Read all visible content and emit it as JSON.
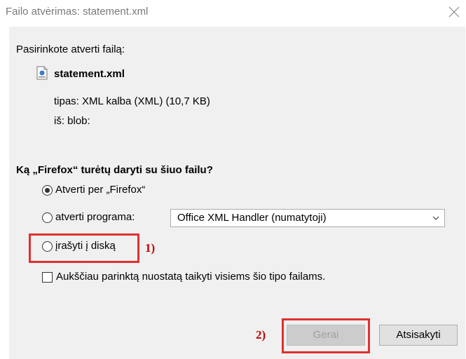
{
  "window": {
    "title": "Failo atvėrimas: statement.xml"
  },
  "intro": "Pasirinkote atverti failą:",
  "file": {
    "icon": "xml-file-icon",
    "name": "statement.xml",
    "type_line": "tipas: XML kalba (XML) (10,7 KB)",
    "from_line": "iš: blob:"
  },
  "question": "Ką „Firefox“ turėtų daryti su šiuo failu?",
  "options": {
    "open_firefox": {
      "label": "Atverti per „Firefox“",
      "checked": true
    },
    "open_program": {
      "label": "atverti programa:",
      "checked": false
    },
    "save_disk": {
      "label": "įrašyti į diską",
      "checked": false
    }
  },
  "program_select": {
    "value": "Office XML Handler (numatytoji)"
  },
  "remember": {
    "label": "Aukščiau parinktą nuostatą taikyti visiems šio tipo failams.",
    "checked": false
  },
  "annotations": {
    "label1": "1)",
    "label2": "2)"
  },
  "buttons": {
    "ok": "Gerai",
    "cancel": "Atsisakyti"
  },
  "colors": {
    "annotation": "#e03030",
    "dialog_bg": "#f0f0f0"
  }
}
